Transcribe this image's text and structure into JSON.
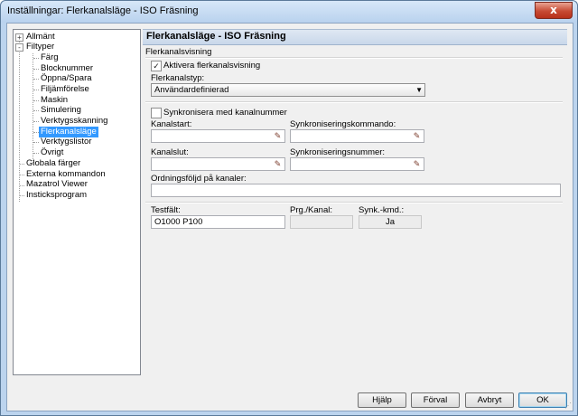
{
  "window": {
    "title": "Inställningar: Flerkanalsläge - ISO Fräsning",
    "close_symbol": "x"
  },
  "tree": [
    {
      "label": "Allmänt",
      "expander": "+"
    },
    {
      "label": "Filtyper",
      "expander": "-"
    },
    {
      "label": "Färg"
    },
    {
      "label": "Blocknummer"
    },
    {
      "label": "Öppna/Spara"
    },
    {
      "label": "Filjämförelse"
    },
    {
      "label": "Maskin"
    },
    {
      "label": "Simulering"
    },
    {
      "label": "Verktygsskanning"
    },
    {
      "label": "Flerkanalsläge",
      "selected": true
    },
    {
      "label": "Verktygslistor"
    },
    {
      "label": "Övrigt"
    },
    {
      "label": "Globala färger"
    },
    {
      "label": "Externa kommandon"
    },
    {
      "label": "Mazatrol Viewer"
    },
    {
      "label": "Insticksprogram"
    }
  ],
  "panel": {
    "header": "Flerkanalsläge - ISO Fräsning",
    "section_label": "Flerkanalsvisning",
    "activate_checkbox": {
      "label": "Aktivera flerkanalsvisning",
      "checked": true,
      "mark": "✓"
    },
    "type_label": "Flerkanalstyp:",
    "type_value": "Användardefinierad",
    "sync_checkbox": {
      "label": "Synkronisera med kanalnummer",
      "checked": false
    },
    "channel_start_label": "Kanalstart:",
    "sync_command_label": "Synkroniseringskommando:",
    "channel_end_label": "Kanalslut:",
    "sync_number_label": "Synkroniseringsnummer:",
    "order_label": "Ordningsföljd på kanaler:",
    "test_field_label": "Testfält:",
    "test_field_value": "O1000 P100",
    "prg_channel_label": "Prg./Kanal:",
    "prg_channel_value": "",
    "sync_cmd_label": "Synk.-kmd.:",
    "sync_cmd_value": "Ja"
  },
  "buttons": {
    "help": "Hjälp",
    "default": "Förval",
    "cancel": "Avbryt",
    "ok": "OK"
  }
}
